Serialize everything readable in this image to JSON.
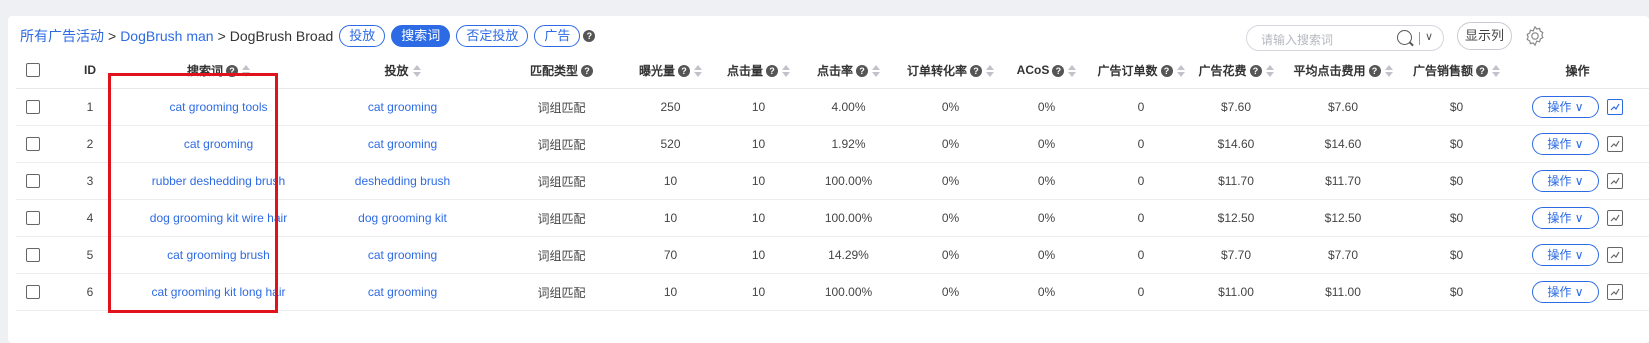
{
  "breadcrumb": {
    "root": "所有广告活动",
    "campaign": "DogBrush man",
    "group": "DogBrush Broad",
    "separator": ">"
  },
  "tabs": [
    {
      "label": "投放",
      "active": false
    },
    {
      "label": "搜索词",
      "active": true
    },
    {
      "label": "否定投放",
      "active": false
    },
    {
      "label": "广告",
      "active": false
    }
  ],
  "search": {
    "placeholder": "请输入搜索词"
  },
  "toolbar": {
    "columns_label": "显示列"
  },
  "table": {
    "headers": [
      "ID",
      "搜索词",
      "投放",
      "匹配类型",
      "曝光量",
      "点击量",
      "点击率",
      "订单转化率",
      "ACoS",
      "广告订单数",
      "广告花费",
      "平均点击费用",
      "广告销售额",
      "操作"
    ],
    "rows": [
      {
        "id": "1",
        "term": "cat grooming tools",
        "target": "cat grooming",
        "match": "词组匹配",
        "impressions": "250",
        "clicks": "10",
        "ctr": "4.00%",
        "cvr": "0%",
        "acos": "0%",
        "orders": "0",
        "spend": "$7.60",
        "cpc": "$7.60",
        "sales": "$0",
        "action": "操作"
      },
      {
        "id": "2",
        "term": "cat grooming",
        "target": "cat grooming",
        "match": "词组匹配",
        "impressions": "520",
        "clicks": "10",
        "ctr": "1.92%",
        "cvr": "0%",
        "acos": "0%",
        "orders": "0",
        "spend": "$14.60",
        "cpc": "$14.60",
        "sales": "$0",
        "action": "操作"
      },
      {
        "id": "3",
        "term": "rubber deshedding brush",
        "target": "deshedding brush",
        "match": "词组匹配",
        "impressions": "10",
        "clicks": "10",
        "ctr": "100.00%",
        "cvr": "0%",
        "acos": "0%",
        "orders": "0",
        "spend": "$11.70",
        "cpc": "$11.70",
        "sales": "$0",
        "action": "操作"
      },
      {
        "id": "4",
        "term": "dog grooming kit wire hair",
        "target": "dog grooming kit",
        "match": "词组匹配",
        "impressions": "10",
        "clicks": "10",
        "ctr": "100.00%",
        "cvr": "0%",
        "acos": "0%",
        "orders": "0",
        "spend": "$12.50",
        "cpc": "$12.50",
        "sales": "$0",
        "action": "操作"
      },
      {
        "id": "5",
        "term": "cat grooming brush",
        "target": "cat grooming",
        "match": "词组匹配",
        "impressions": "70",
        "clicks": "10",
        "ctr": "14.29%",
        "cvr": "0%",
        "acos": "0%",
        "orders": "0",
        "spend": "$7.70",
        "cpc": "$7.70",
        "sales": "$0",
        "action": "操作"
      },
      {
        "id": "6",
        "term": "cat grooming kit long hair",
        "target": "cat grooming",
        "match": "词组匹配",
        "impressions": "10",
        "clicks": "10",
        "ctr": "100.00%",
        "cvr": "0%",
        "acos": "0%",
        "orders": "0",
        "spend": "$11.00",
        "cpc": "$11.00",
        "sales": "$0",
        "action": "操作"
      }
    ]
  },
  "colors": {
    "accent": "#2d6be4",
    "highlight": "#e0121b"
  }
}
